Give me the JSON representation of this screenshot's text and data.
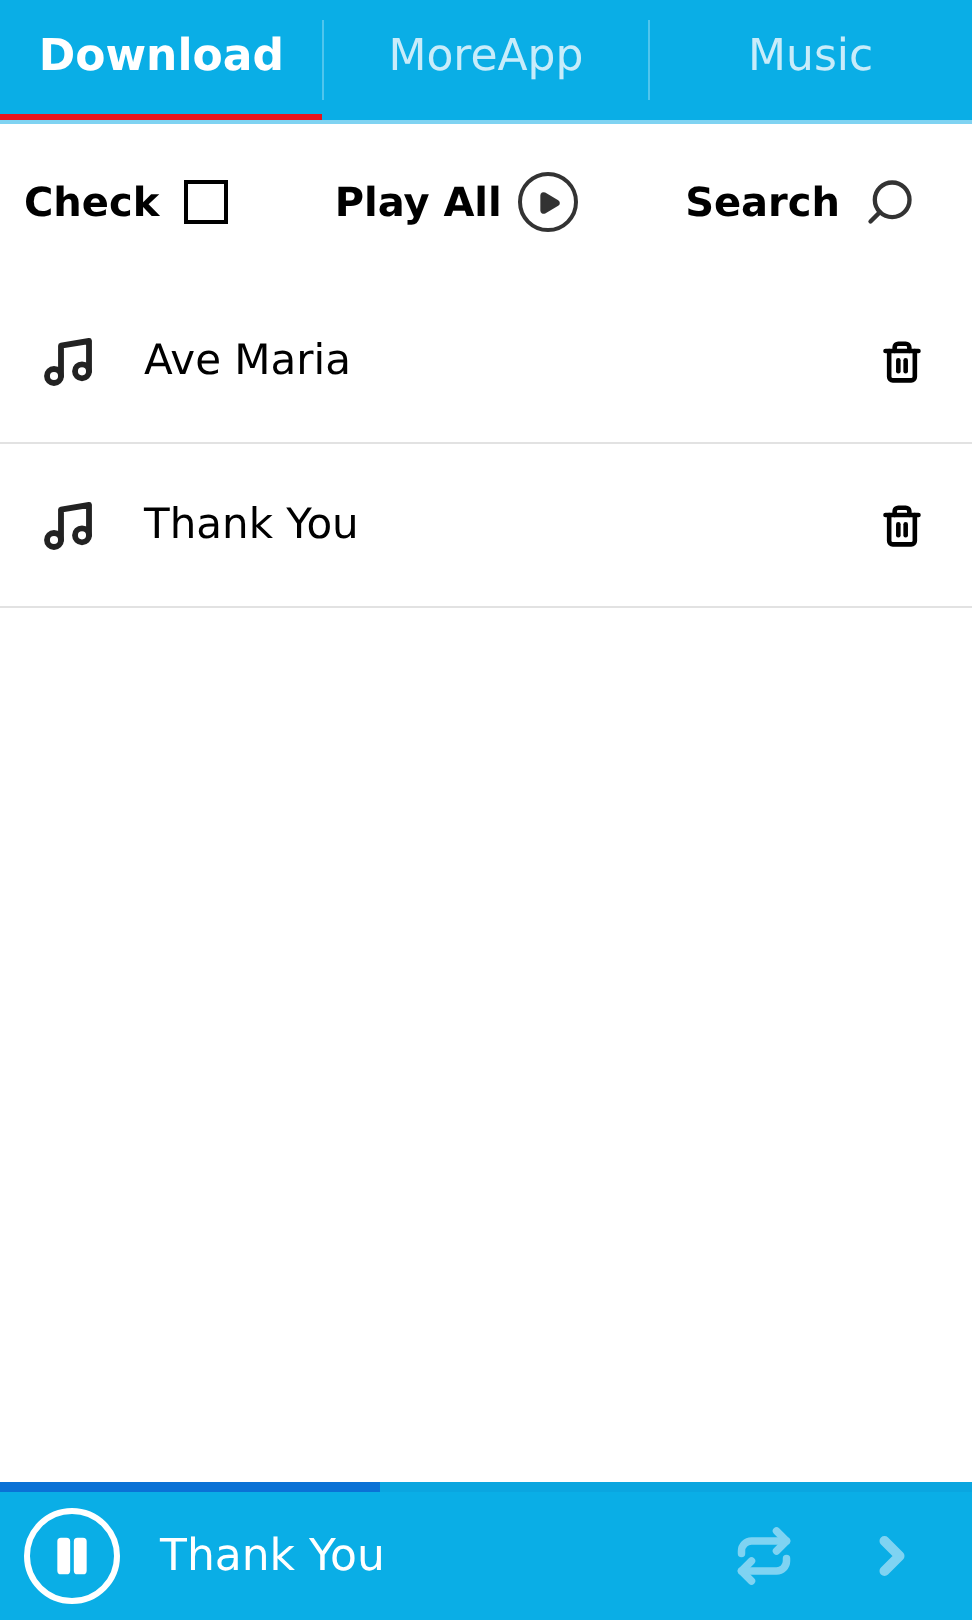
{
  "tabs": [
    {
      "label": "Download",
      "selected": true
    },
    {
      "label": "MoreApp",
      "selected": false
    },
    {
      "label": "Music",
      "selected": false
    }
  ],
  "toolbar": {
    "check": {
      "label": "Check",
      "checked": false
    },
    "play_all": {
      "label": "Play All"
    },
    "search": {
      "label": "Search"
    }
  },
  "songs": [
    {
      "title": "Ave Maria"
    },
    {
      "title": "Thank You"
    }
  ],
  "player": {
    "level": 0.39,
    "title": "Thank You",
    "playing": true
  }
}
